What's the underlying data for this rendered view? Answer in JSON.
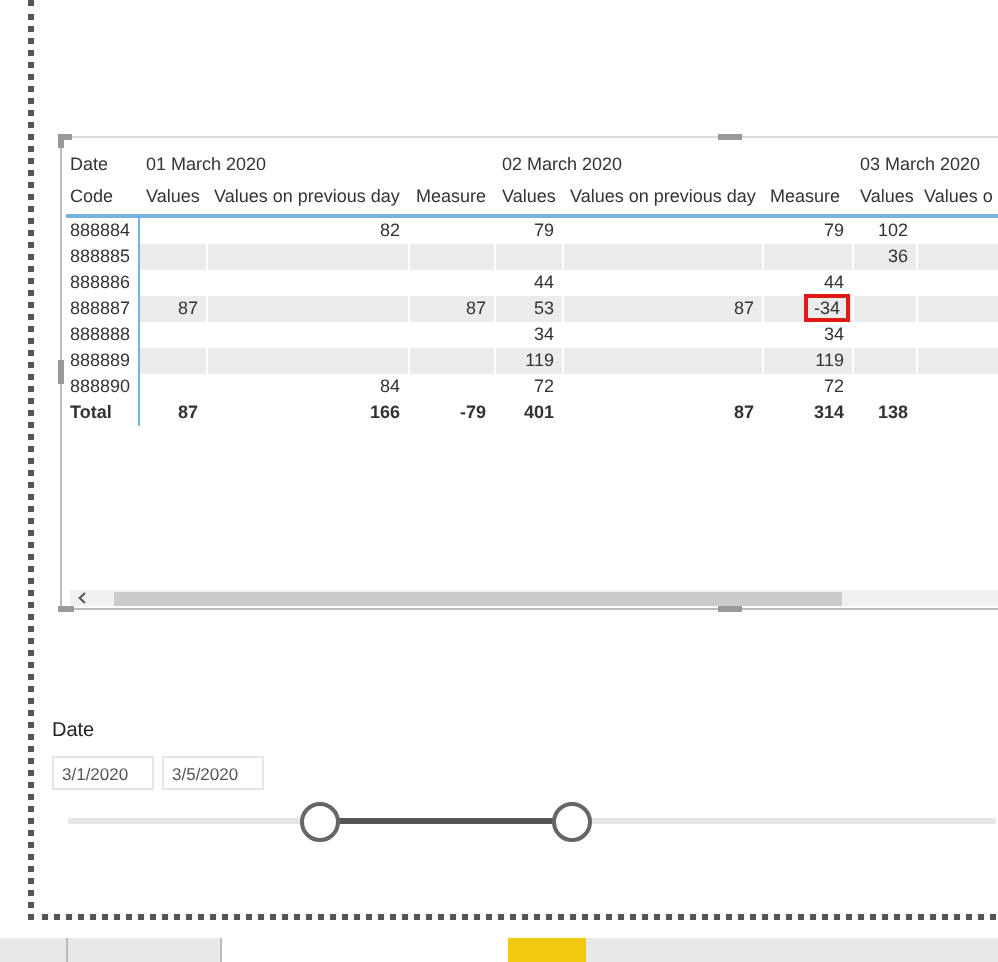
{
  "table": {
    "row_header": [
      "Date",
      "Code"
    ],
    "date_groups": [
      "01 March 2020",
      "02 March 2020",
      "03 March 2020"
    ],
    "columns": [
      "Values",
      "Values on previous day",
      "Measure",
      "Values",
      "Values on previous day",
      "Measure",
      "Values",
      "Values o"
    ],
    "rows": [
      {
        "code": "888884",
        "cells": [
          null,
          "82",
          null,
          "79",
          null,
          "79",
          "102",
          null
        ]
      },
      {
        "code": "888885",
        "cells": [
          null,
          null,
          null,
          null,
          null,
          null,
          "36",
          null
        ]
      },
      {
        "code": "888886",
        "cells": [
          null,
          null,
          null,
          "44",
          null,
          "44",
          null,
          null
        ]
      },
      {
        "code": "888887",
        "cells": [
          "87",
          null,
          "87",
          "53",
          "87",
          {
            "text": "-34",
            "circled": true
          },
          null,
          null
        ]
      },
      {
        "code": "888888",
        "cells": [
          null,
          null,
          null,
          "34",
          null,
          "34",
          null,
          null
        ]
      },
      {
        "code": "888889",
        "cells": [
          null,
          null,
          null,
          "119",
          null,
          "119",
          null,
          null
        ]
      },
      {
        "code": "888890",
        "cells": [
          null,
          "84",
          null,
          "72",
          null,
          "72",
          null,
          null
        ]
      }
    ],
    "total": {
      "label": "Total",
      "cells": [
        "87",
        "166",
        "-79",
        "401",
        "87",
        "314",
        "138",
        null
      ]
    }
  },
  "slicer": {
    "title": "Date",
    "start": "3/1/2020",
    "end": "3/5/2020",
    "thumbs": [
      {
        "level": 0.27
      },
      {
        "level": 0.54
      }
    ]
  },
  "page_tabs": [
    {
      "selected": false
    },
    {
      "selected": false
    },
    {
      "selected": true
    }
  ]
}
